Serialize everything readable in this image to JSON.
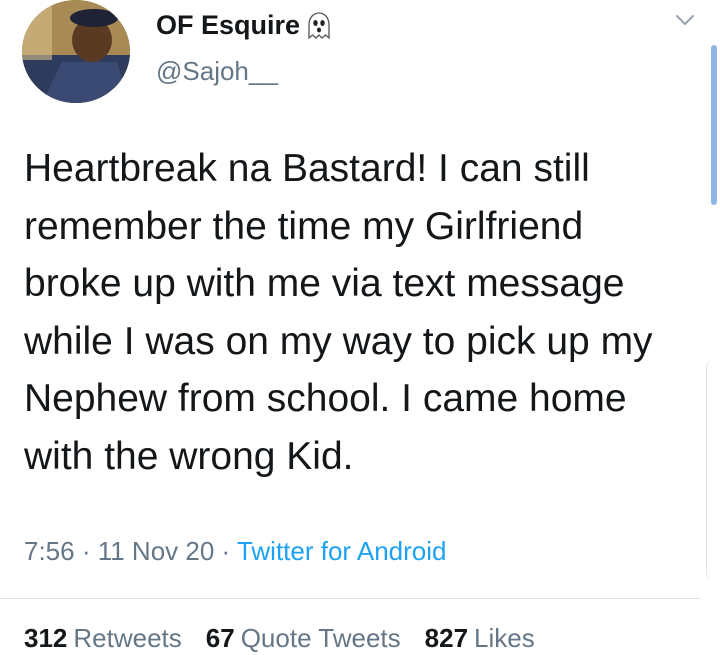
{
  "author": {
    "display_name": "OF Esquire",
    "handle": "@Sajoh__",
    "emoji": "ghost-icon"
  },
  "tweet": {
    "text": "Heartbreak na Bastard! I can still remember the time my Girlfriend broke up with me via text message while I was on my way to pick up my Nephew from school. I came home with the wrong Kid.",
    "time": "7:56",
    "date": "11 Nov 20",
    "separator": " · ",
    "source": "Twitter for Android"
  },
  "stats": {
    "retweets": {
      "count": "312",
      "label": "Retweets"
    },
    "quote_tweets": {
      "count": "67",
      "label": "Quote Tweets"
    },
    "likes": {
      "count": "827",
      "label": "Likes"
    }
  },
  "colors": {
    "link": "#1da1f2",
    "secondary_text": "#657786",
    "primary_text": "#14171a"
  },
  "icons": {
    "menu": "chevron-down-icon"
  }
}
